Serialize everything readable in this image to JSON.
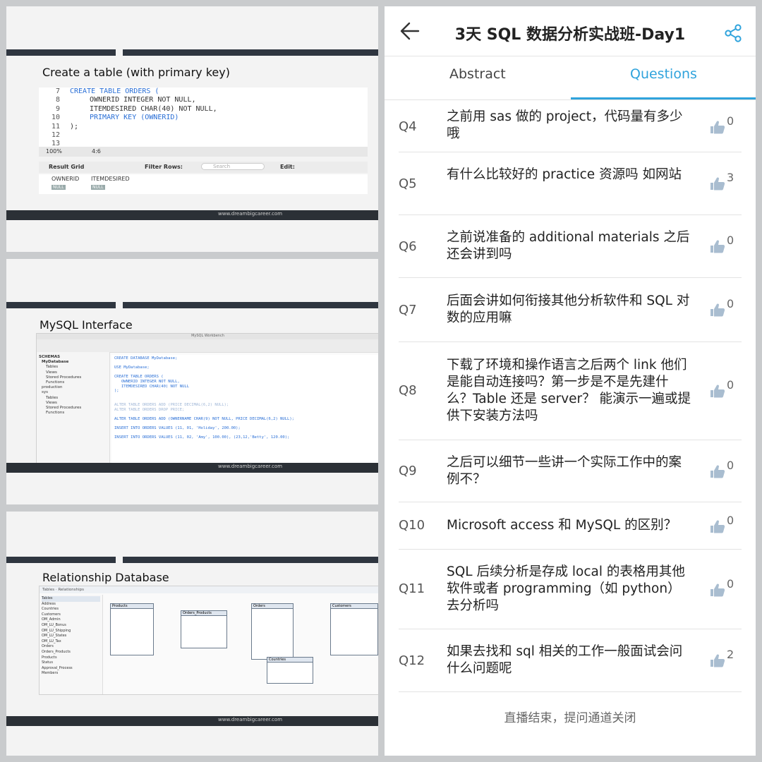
{
  "slides": [
    {
      "title": "Create a table (with primary key)",
      "footer": "www.dreambigcareer.com",
      "code_lines": [
        {
          "n": "7",
          "text": "CREATE TABLE ORDERS ("
        },
        {
          "n": "8",
          "text": "OWNERID INTEGER NOT NULL,"
        },
        {
          "n": "9",
          "text": "ITEMDESIRED CHAR(40) NOT NULL,"
        },
        {
          "n": "10",
          "text": "PRIMARY KEY (OWNERID)"
        },
        {
          "n": "11",
          "text": ");"
        },
        {
          "n": "12",
          "text": ""
        },
        {
          "n": "13",
          "text": ""
        }
      ],
      "zoom": "100%",
      "position": "4:6",
      "result_grid_label": "Result Grid",
      "filter_label": "Filter Rows:",
      "search_placeholder": "Search",
      "edit_label": "Edit:",
      "columns": [
        "OWNERID",
        "ITEMDESIRED"
      ],
      "null_cell": "NULL"
    },
    {
      "title": "MySQL Interface",
      "window_title": "MySQL Workbench",
      "footer": "www.dreambigcareer.com",
      "schemas_label": "SCHEMAS",
      "tree": [
        "MyDatabase",
        "Tables",
        "Views",
        "Stored Procedures",
        "Functions",
        "production",
        "sys",
        "Tables",
        "Views",
        "Stored Procedures",
        "Functions"
      ],
      "sql_lines": [
        "CREATE DATABASE MyDatabase;",
        "USE MyDatabase;",
        "CREATE TABLE ORDERS (",
        "OWNERID INTEGER NOT NULL,",
        "ITEMDESIRED CHAR(40) NOT NULL",
        ");",
        "ALTER TABLE ORDERS ADD (PRICE DECIMAL(6,2) NULL);",
        "ALTER TABLE ORDERS DROP PRICE;",
        "ALTER TABLE ORDERS ADD (OWNERNAME CHAR(9) NOT NULL, PRICE DECIMAL(6,2) NULL);",
        "INSERT INTO ORDERS VALUES (11, 01, 'Holiday', 200.00);",
        "INSERT INTO ORDERS VALUES (11, 02, 'Amy', 100.00), (23,12,'Betty', 120.00);"
      ]
    },
    {
      "title": "Relationship Database",
      "footer": "www.dreambigcareer.com",
      "breadcrumb": "Tables · Relationships",
      "tables_list": [
        "Tables",
        "Address",
        "Countries",
        "Customers",
        "OM_Admin",
        "OM_LU_Bonus",
        "OM_LU_Shipping",
        "OM_LU_States",
        "OM_LU_Tax",
        "Orders",
        "Orders_Products",
        "Products",
        "Status",
        "Approval_Process",
        "Members"
      ],
      "entities": [
        "Products",
        "Orders_Products",
        "Orders",
        "Customers",
        "Countries"
      ]
    }
  ],
  "app": {
    "title": "3天 SQL 数据分析实战班-Day1",
    "back_icon": "arrow-left-icon",
    "share_icon": "share-icon",
    "tabs": [
      {
        "label": "Abstract",
        "active": false
      },
      {
        "label": "Questions",
        "active": true
      }
    ],
    "accent_color": "#2fa3dc",
    "questions": [
      {
        "id": "Q4",
        "text": "之前用 sas 做的 project，代码量有多少哦",
        "likes": "0"
      },
      {
        "id": "Q5",
        "text": "有什么比较好的 practice 资源吗 如网站",
        "likes": "3"
      },
      {
        "id": "Q6",
        "text": "之前说准备的 additional materials 之后还会讲到吗",
        "likes": "0"
      },
      {
        "id": "Q7",
        "text": "后面会讲如何衔接其他分析软件和 SQL 对数的应用嘛",
        "likes": "0"
      },
      {
        "id": "Q8",
        "text": "下载了环境和操作语言之后两个 link 他们是能自动连接吗？第一步是不是先建什么？Table 还是 server？ 能演示一遍或提供下安装方法吗",
        "likes": "0"
      },
      {
        "id": "Q9",
        "text": "之后可以细节一些讲一个实际工作中的案例不？",
        "likes": "0"
      },
      {
        "id": "Q10",
        "text": "Microsoft access 和 MySQL 的区别？",
        "likes": "0"
      },
      {
        "id": "Q11",
        "text": "SQL 后续分析是存成 local 的表格用其他软件或者 programming（如 python）去分析吗",
        "likes": "0"
      },
      {
        "id": "Q12",
        "text": "如果去找和 sql 相关的工作一般面试会问什么问题呢",
        "likes": "2"
      }
    ],
    "closed_notice": "直播结束，提问通道关闭"
  }
}
